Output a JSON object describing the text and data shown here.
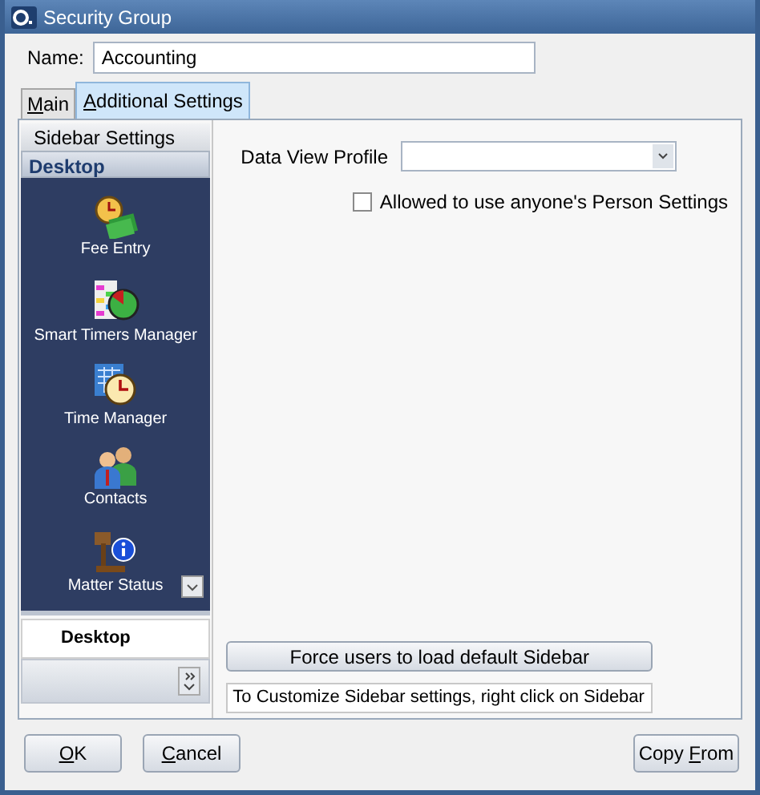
{
  "window": {
    "title": "Security Group"
  },
  "name_field": {
    "label": "Name:",
    "value": "Accounting"
  },
  "tabs": [
    {
      "label": [
        {
          "text": "M",
          "underlined": true
        },
        {
          "text": "ain",
          "underlined": false
        }
      ],
      "selected": false
    },
    {
      "label": [
        {
          "text": "A",
          "underlined": true
        },
        {
          "text": "dditional Settings",
          "underlined": false
        }
      ],
      "selected": true
    }
  ],
  "sidebar": {
    "title": "Sidebar Settings",
    "group": "Desktop",
    "items": [
      {
        "label": "Fee Entry"
      },
      {
        "label": "Smart Timers Manager"
      },
      {
        "label": "Time Manager"
      },
      {
        "label": "Contacts"
      },
      {
        "label": "Matter Status"
      }
    ],
    "footer_group": "Desktop"
  },
  "data_view_profile": {
    "label": "Data View Profile"
  },
  "person_settings": {
    "label": "Allowed to use anyone's Person Settings",
    "checked": false
  },
  "force_button": {
    "label": "Force users to load default Sidebar"
  },
  "hint": "To Customize Sidebar settings, right click on  Sidebar",
  "buttons": [
    {
      "label": [
        {
          "text": "O",
          "underlined": true
        },
        {
          "text": "K",
          "underlined": false
        }
      ],
      "kind": "left"
    },
    {
      "label": [
        {
          "text": "C",
          "underlined": true
        },
        {
          "text": "ancel",
          "underlined": false
        }
      ],
      "kind": "left"
    },
    {
      "label": [
        {
          "text": "Copy ",
          "underlined": false
        },
        {
          "text": "F",
          "underlined": true
        },
        {
          "text": "rom",
          "underlined": false
        }
      ],
      "kind": "right"
    }
  ]
}
